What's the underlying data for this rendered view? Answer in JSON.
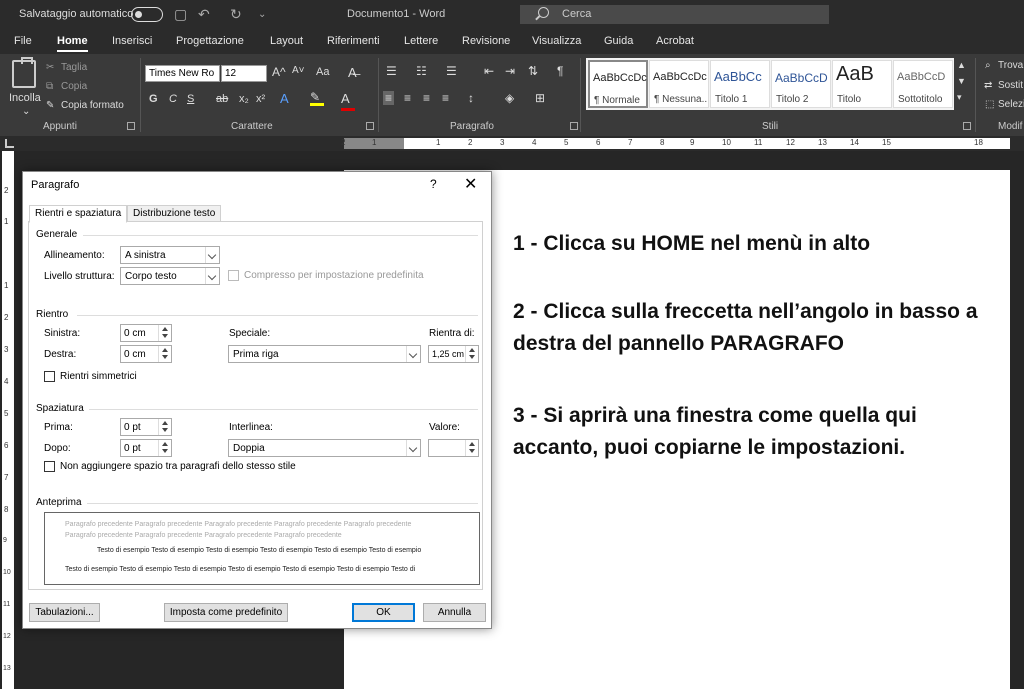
{
  "titlebar": {
    "autosave_label": "Salvataggio automatico",
    "doc_title": "Documento1  -  Word",
    "search_placeholder": "Cerca",
    "save_icon": "save-icon",
    "undo_icon": "undo-icon",
    "redo_icon": "redo-icon"
  },
  "tabs": [
    "File",
    "Home",
    "Inserisci",
    "Progettazione",
    "Layout",
    "Riferimenti",
    "Lettere",
    "Revisione",
    "Visualizza",
    "Guida",
    "Acrobat"
  ],
  "ribbon": {
    "clipboard": {
      "label": "Appunti",
      "paste": "Incolla",
      "cut": "Taglia",
      "copy": "Copia",
      "format_painter": "Copia formato"
    },
    "font": {
      "label": "Carattere",
      "font_name": "Times New Ro",
      "font_size": "12",
      "bold": "G",
      "italic": "C",
      "underline": "S",
      "strike": "ab",
      "subscript": "x₂",
      "superscript": "x²",
      "grow": "A^",
      "shrink": "A˅",
      "change_case": "Aa",
      "text_effects": "A",
      "font_color": "A"
    },
    "paragraph": {
      "label": "Paragrafo"
    },
    "styles": {
      "label": "Stili",
      "items": [
        {
          "sample": "AaBbCcDc",
          "name": "¶ Normale"
        },
        {
          "sample": "AaBbCcDc",
          "name": "¶ Nessuna..."
        },
        {
          "sample": "AaBbCc",
          "name": "Titolo 1"
        },
        {
          "sample": "AaBbCcD",
          "name": "Titolo 2"
        },
        {
          "sample": "AaB",
          "name": "Titolo"
        },
        {
          "sample": "AaBbCcD",
          "name": "Sottotitolo"
        }
      ]
    },
    "editing": {
      "label": "Modif",
      "find": "Trova",
      "replace": "Sostit",
      "select": "Selezi"
    }
  },
  "hruler": [
    "2",
    "1",
    "1",
    "2",
    "3",
    "4",
    "5",
    "6",
    "7",
    "8",
    "9",
    "10",
    "11",
    "12",
    "13",
    "14",
    "15",
    "18"
  ],
  "vruler": [
    "2",
    "1",
    "1",
    "2",
    "3",
    "4",
    "5",
    "6",
    "7",
    "8",
    "9",
    "10",
    "11",
    "12",
    "13"
  ],
  "notes": [
    "1 - Clicca su HOME nel menù in alto",
    "2 - Clicca sulla freccetta nell’angolo in basso a destra del pannello PARAGRAFO",
    "3 - Si aprirà una finestra come quella qui accanto, puoi copiarne le impostazioni."
  ],
  "dialog": {
    "title": "Paragrafo",
    "help": "?",
    "close": "✕",
    "tabs": [
      "Rientri e spaziatura",
      "Distribuzione testo"
    ],
    "general": {
      "heading": "Generale",
      "alignment_label": "Allineamento:",
      "alignment_value": "A sinistra",
      "level_label": "Livello struttura:",
      "level_value": "Corpo testo",
      "collapsed_label": "Compresso per impostazione predefinita"
    },
    "indent": {
      "heading": "Rientro",
      "left_label": "Sinistra:",
      "left_value": "0 cm",
      "right_label": "Destra:",
      "right_value": "0 cm",
      "special_label": "Speciale:",
      "special_value": "Prima riga",
      "by_label": "Rientra di:",
      "by_value": "1,25 cm",
      "mirror_label": "Rientri simmetrici"
    },
    "spacing": {
      "heading": "Spaziatura",
      "before_label": "Prima:",
      "before_value": "0 pt",
      "after_label": "Dopo:",
      "after_value": "0 pt",
      "line_label": "Interlinea:",
      "line_value": "Doppia",
      "at_label": "Valore:",
      "at_value": "",
      "no_space_label": "Non aggiungere spazio tra paragrafi dello stesso stile"
    },
    "preview": {
      "heading": "Anteprima",
      "prev_line1": "Paragrafo precedente Paragrafo precedente Paragrafo precedente Paragrafo precedente Paragrafo precedente",
      "prev_line2": "Paragrafo precedente Paragrafo precedente Paragrafo precedente Paragrafo precedente",
      "sample_line1": "Testo di esempio Testo di esempio Testo di esempio Testo di esempio Testo di esempio Testo di esempio",
      "sample_line2": "Testo di esempio Testo di esempio Testo di esempio Testo di esempio Testo di esempio Testo di esempio Testo di"
    },
    "buttons": {
      "tabs": "Tabulazioni...",
      "default": "Imposta come predefinito",
      "ok": "OK",
      "cancel": "Annulla"
    }
  }
}
